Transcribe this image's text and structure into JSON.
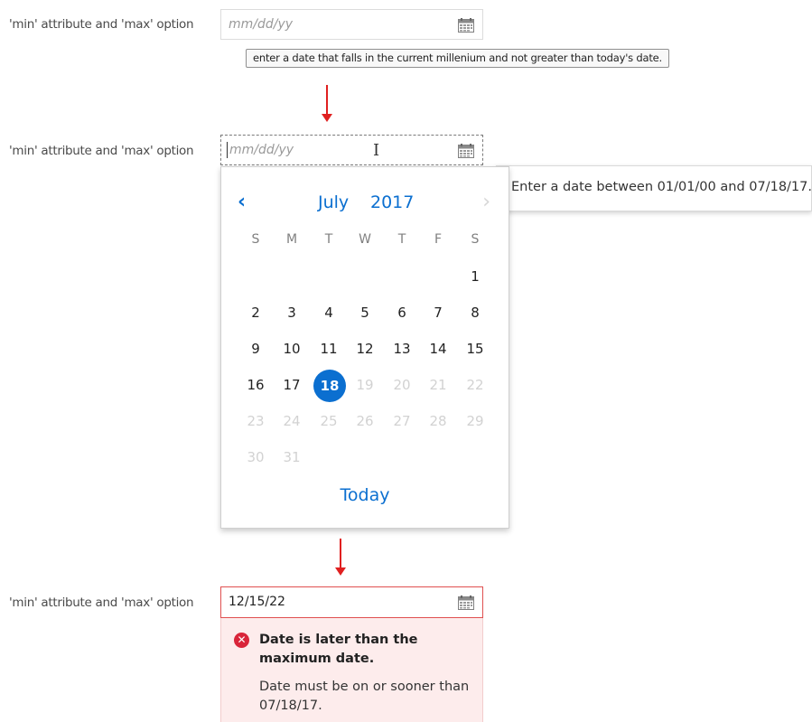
{
  "rows": {
    "label": "'min' attribute and 'max' option",
    "placeholder": "mm/dd/yy",
    "error_value": "12/15/22"
  },
  "tooltip": "enter a date that falls in the current millenium and not greater than today's date.",
  "hint": "Enter a date between 01/01/00 and 07/18/17.",
  "calendar": {
    "month": "July",
    "year": "2017",
    "weekdays": [
      "S",
      "M",
      "T",
      "W",
      "T",
      "F",
      "S"
    ],
    "days": [
      "1",
      "2",
      "3",
      "4",
      "5",
      "6",
      "7",
      "8",
      "9",
      "10",
      "11",
      "12",
      "13",
      "14",
      "15",
      "16",
      "17",
      "18",
      "19",
      "20",
      "21",
      "22",
      "23",
      "24",
      "25",
      "26",
      "27",
      "28",
      "29",
      "30",
      "31"
    ],
    "selected_day": "18",
    "today_label": "Today",
    "prev_icon": "chevron-left-icon",
    "next_icon": "chevron-right-icon"
  },
  "error": {
    "title": "Date is later than the maximum date.",
    "detail": "Date must be on or sooner than 07/18/17."
  },
  "colors": {
    "accent": "#0b6fd0",
    "error": "#d9253a",
    "arrow": "#e02020"
  }
}
